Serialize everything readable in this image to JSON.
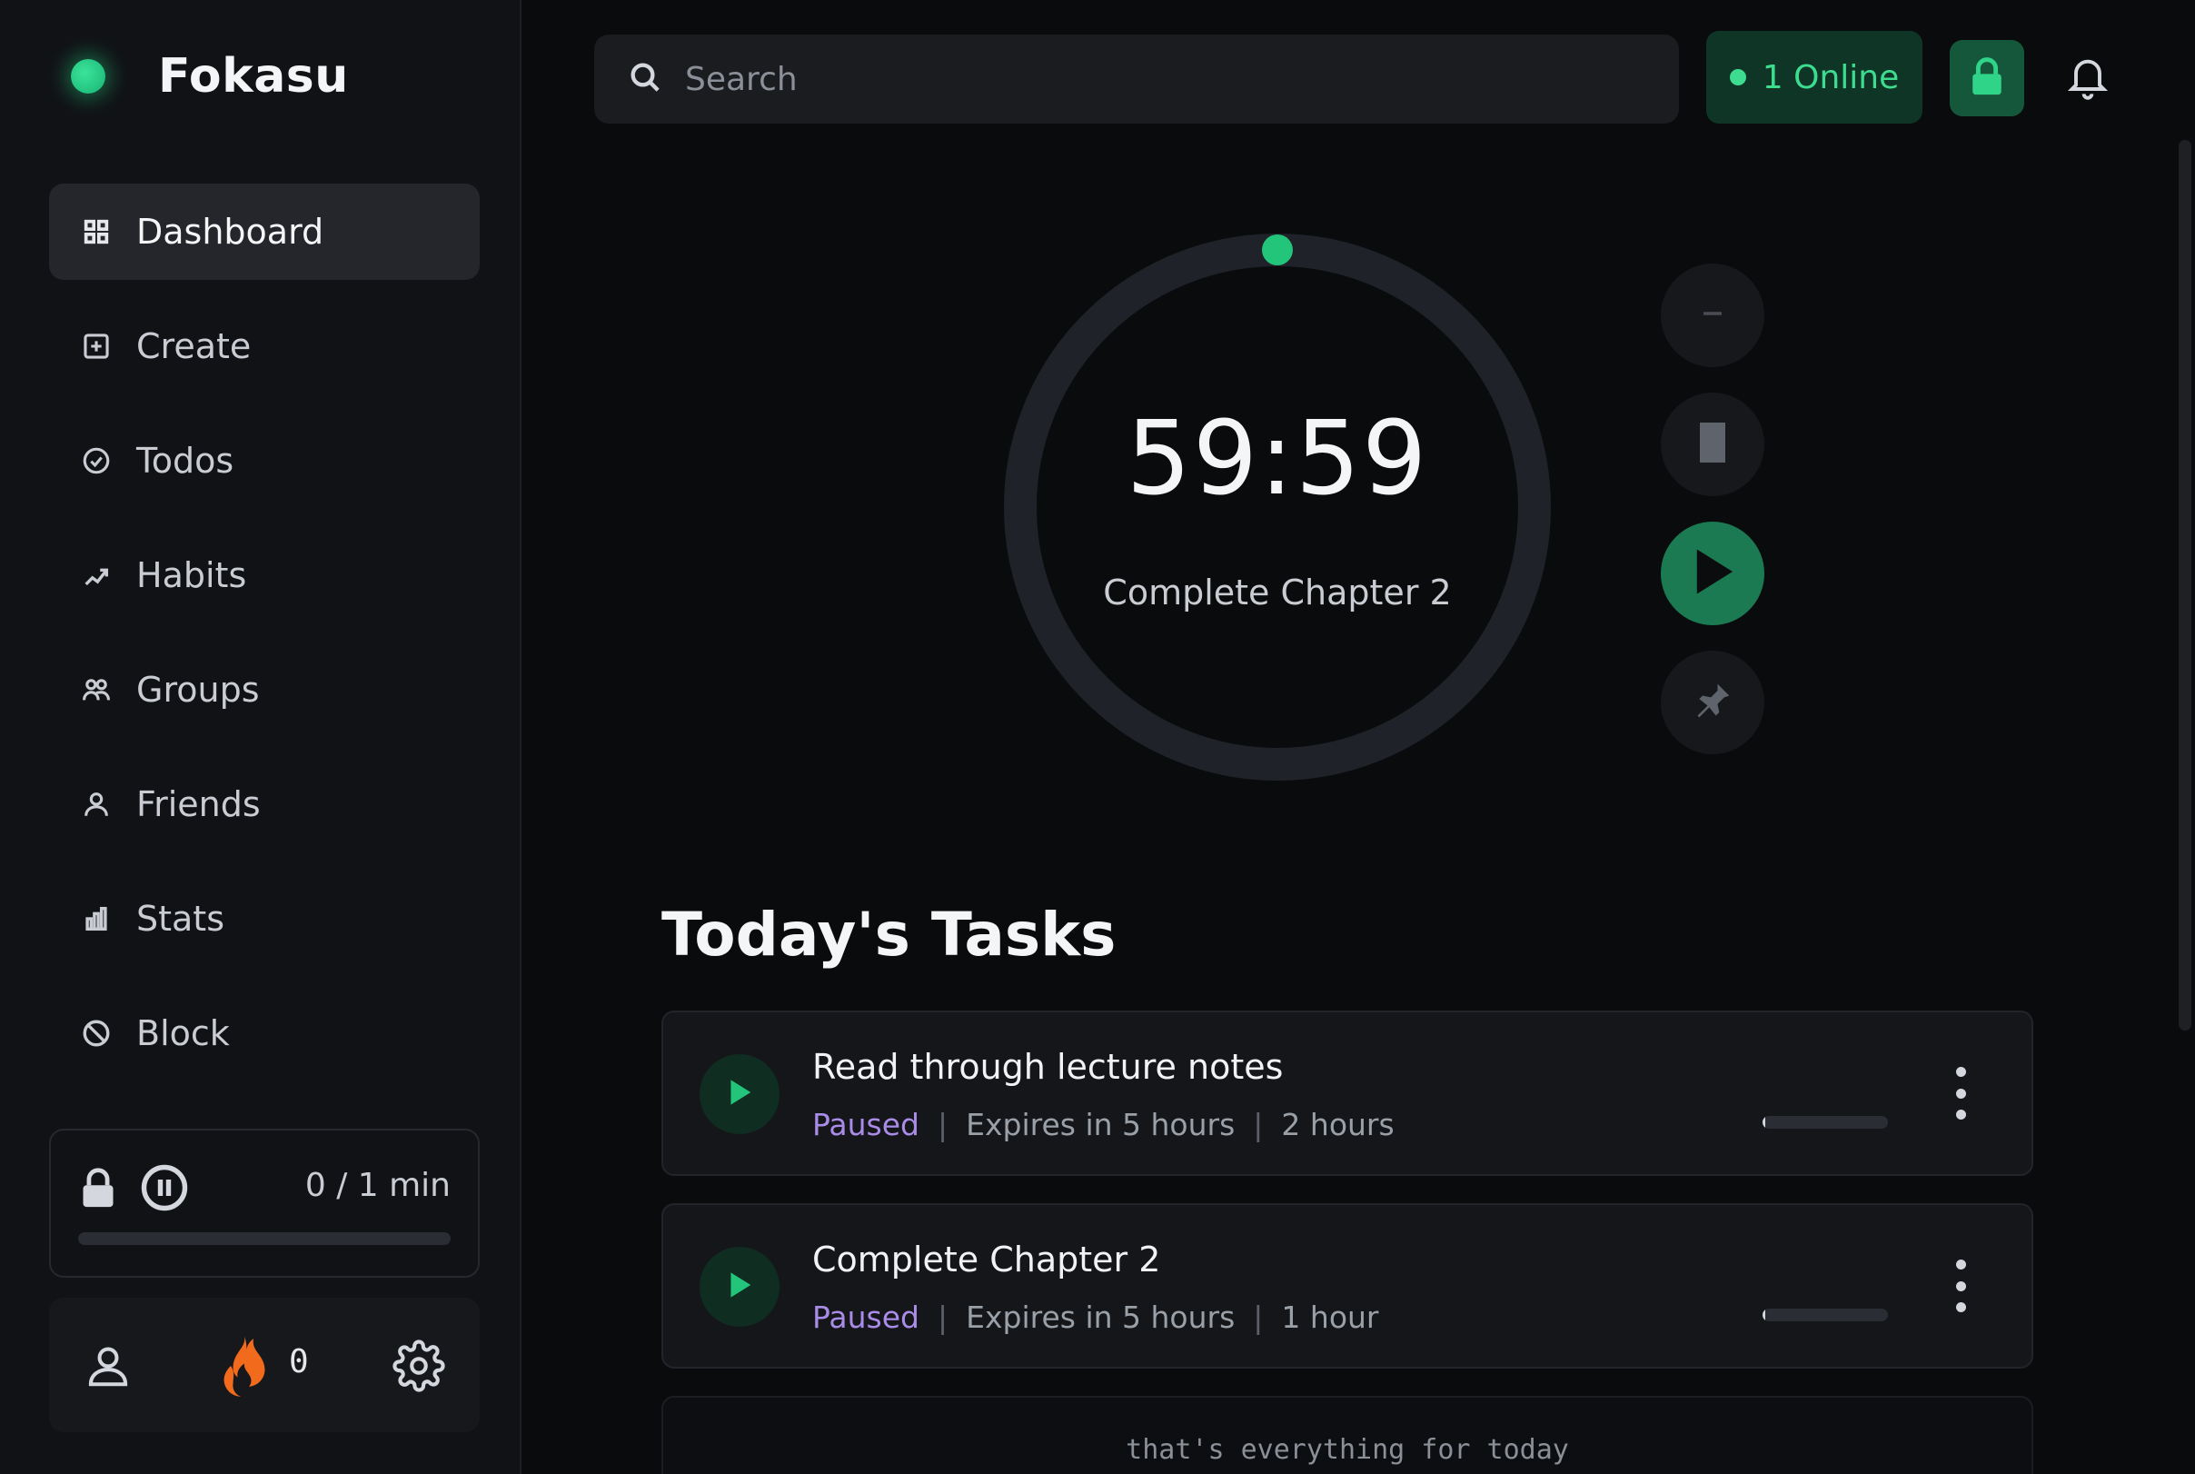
{
  "app": {
    "name": "Fokasu"
  },
  "sidebar": {
    "items": [
      {
        "label": "Dashboard",
        "icon": "grid-icon",
        "active": true
      },
      {
        "label": "Create",
        "icon": "plus-square-icon"
      },
      {
        "label": "Todos",
        "icon": "check-circle-icon"
      },
      {
        "label": "Habits",
        "icon": "trend-icon"
      },
      {
        "label": "Groups",
        "icon": "users-icon"
      },
      {
        "label": "Friends",
        "icon": "user-icon"
      },
      {
        "label": "Stats",
        "icon": "bar-chart-icon"
      },
      {
        "label": "Block",
        "icon": "ban-icon"
      }
    ],
    "focus": {
      "time": "0 / 1 min",
      "progress": 0
    },
    "streak": {
      "count": "0"
    }
  },
  "header": {
    "search": {
      "placeholder": "Search"
    },
    "online": {
      "label": "1 Online"
    }
  },
  "timer": {
    "time": "59:59",
    "task": "Complete Chapter 2",
    "progress": 0
  },
  "tasks": {
    "title": "Today's Tasks",
    "items": [
      {
        "title": "Read through lecture notes",
        "status": "Paused",
        "expires": "Expires in 5 hours",
        "duration": "2 hours",
        "progress": 0.02
      },
      {
        "title": "Complete Chapter 2",
        "status": "Paused",
        "expires": "Expires in 5 hours",
        "duration": "1 hour",
        "progress": 0.02
      }
    ],
    "empty_message": "that's everything for today"
  },
  "colors": {
    "accent": "#22c57a",
    "status_paused": "#a98be8",
    "background": "#0a0b0d",
    "sidebar": "#111216"
  }
}
